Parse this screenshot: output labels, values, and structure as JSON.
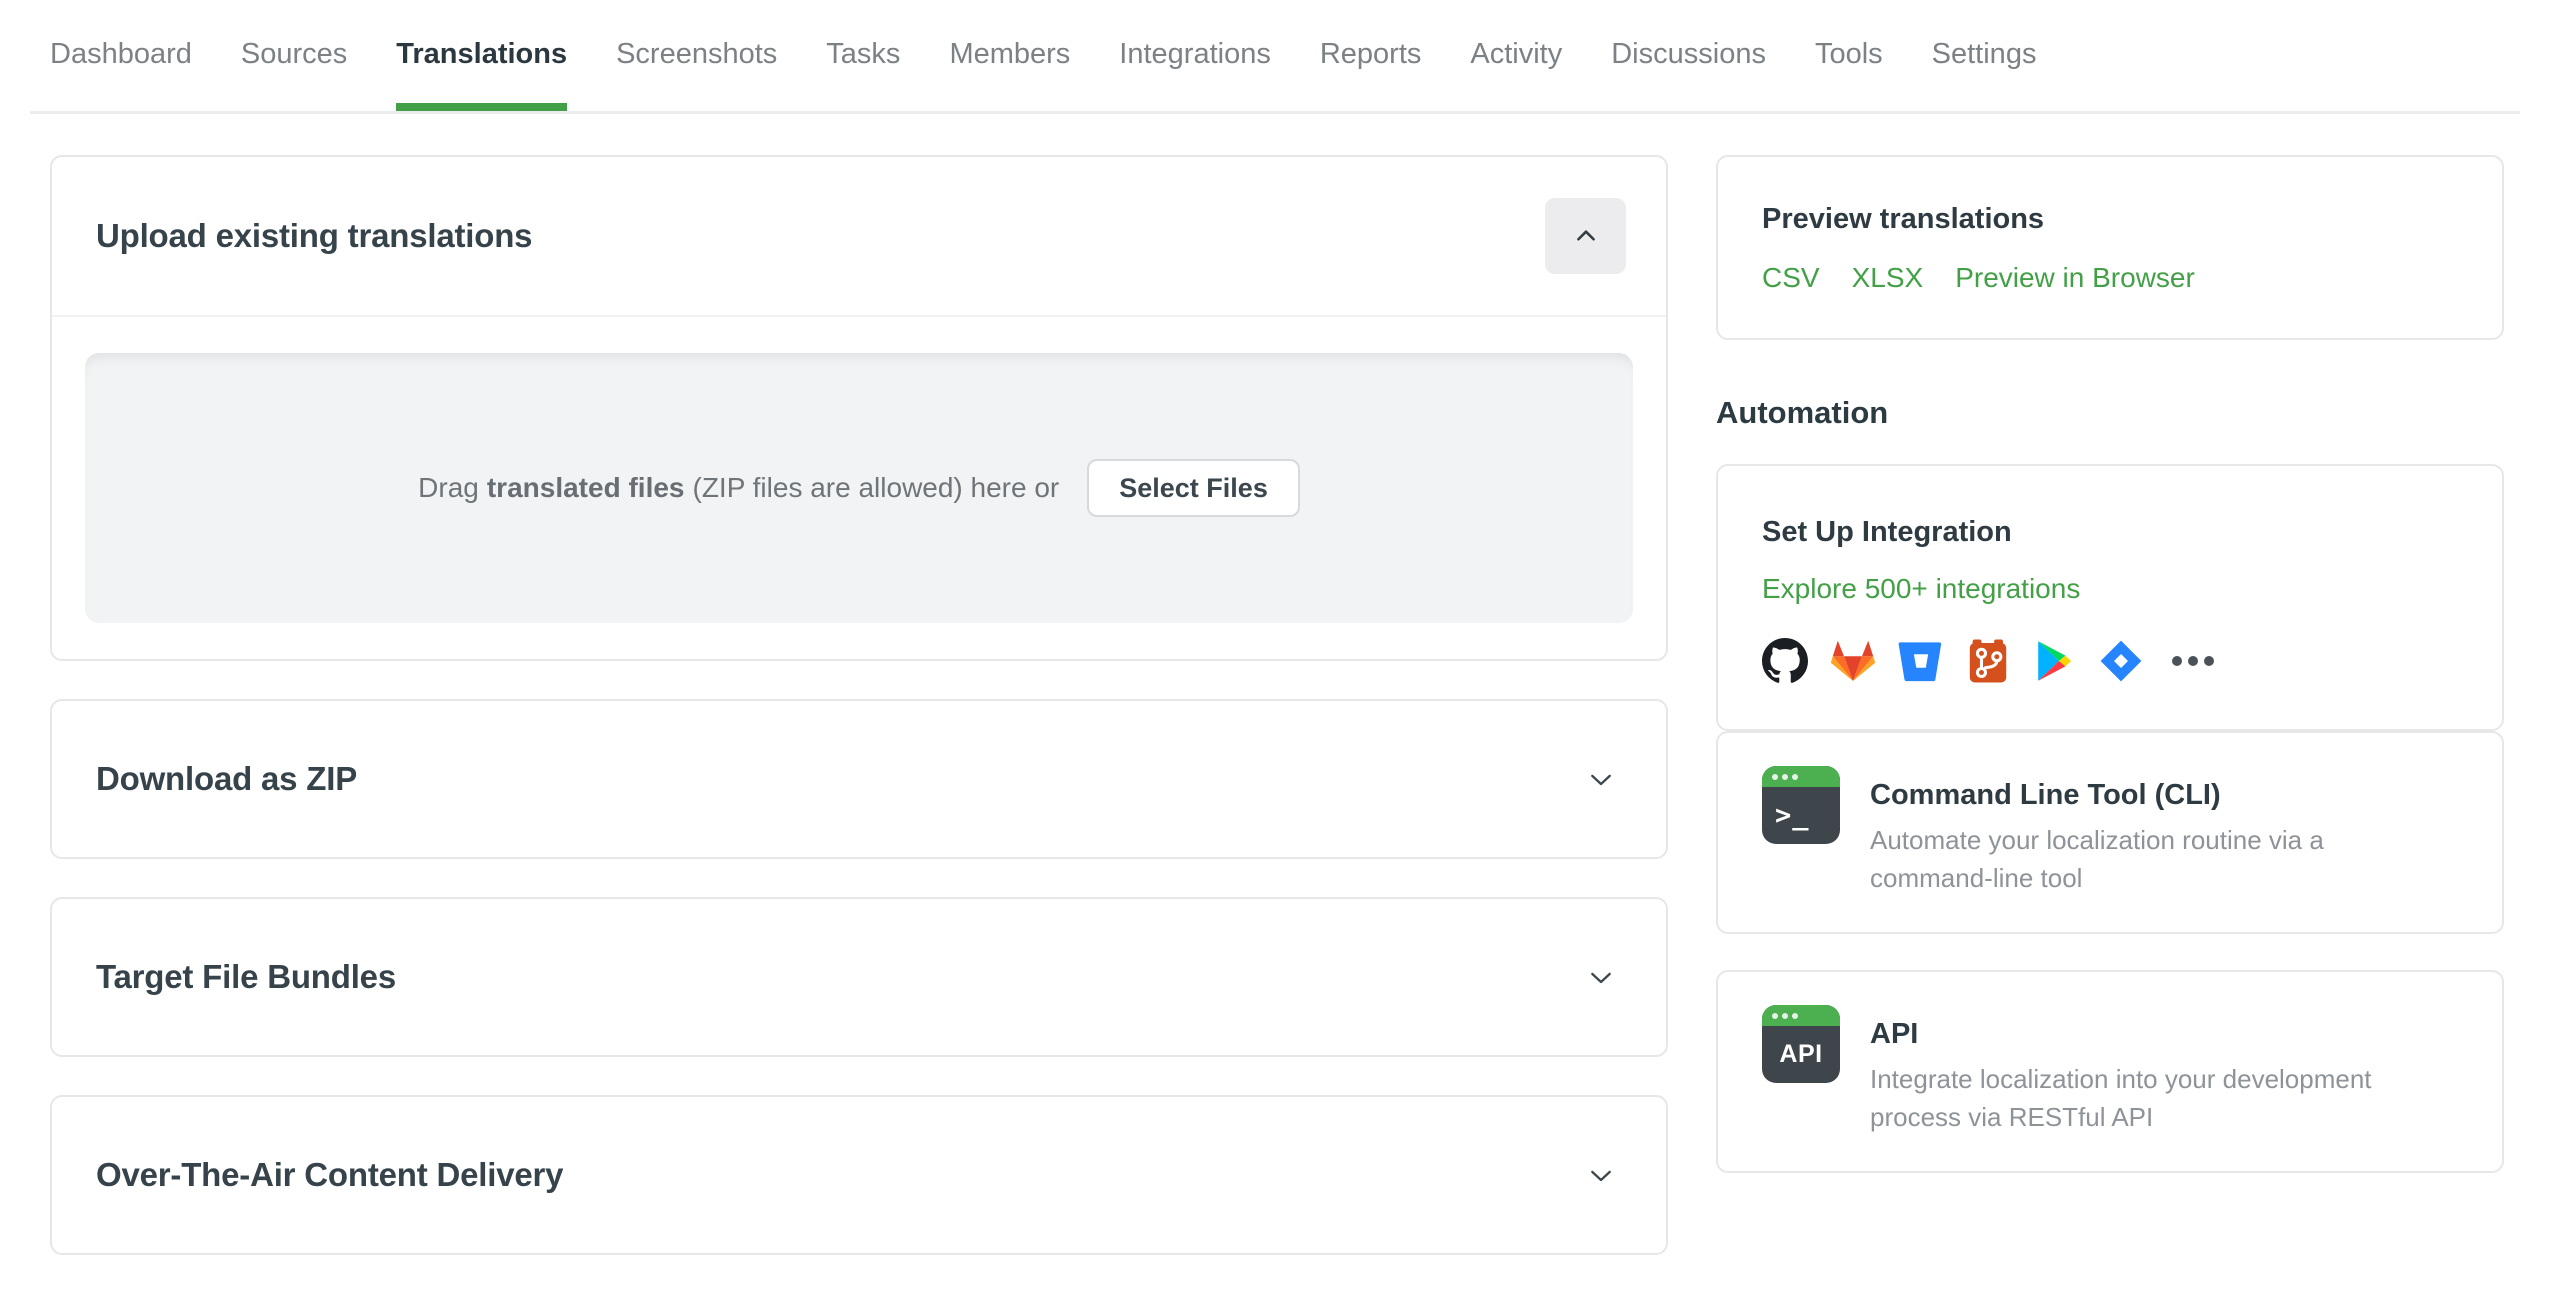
{
  "colors": {
    "accent_green": "#43a047",
    "tab_active": "#2b3840",
    "heading_dark": "#36434b",
    "muted_text": "#8d9398",
    "terminal_bar_green": "#4caf50",
    "terminal_body_dark": "#3e464b"
  },
  "nav": {
    "tabs": [
      {
        "label": "Dashboard",
        "active": false
      },
      {
        "label": "Sources",
        "active": false
      },
      {
        "label": "Translations",
        "active": true
      },
      {
        "label": "Screenshots",
        "active": false
      },
      {
        "label": "Tasks",
        "active": false
      },
      {
        "label": "Members",
        "active": false
      },
      {
        "label": "Integrations",
        "active": false
      },
      {
        "label": "Reports",
        "active": false
      },
      {
        "label": "Activity",
        "active": false
      },
      {
        "label": "Discussions",
        "active": false
      },
      {
        "label": "Tools",
        "active": false
      },
      {
        "label": "Settings",
        "active": false
      }
    ]
  },
  "upload": {
    "title": "Upload existing translations",
    "collapse_icon": "chevron-up",
    "drag_prefix": "Drag",
    "drag_bold": "translated files",
    "drag_suffix": "(ZIP files are allowed) here or",
    "select_button": "Select Files"
  },
  "collapsed_panels": [
    {
      "title": "Download as ZIP",
      "icon": "chevron-down"
    },
    {
      "title": "Target File Bundles",
      "icon": "chevron-down"
    },
    {
      "title": "Over-The-Air Content Delivery",
      "icon": "chevron-down"
    }
  ],
  "sidebar": {
    "preview": {
      "title": "Preview translations",
      "links": [
        {
          "label": "CSV"
        },
        {
          "label": "XLSX"
        },
        {
          "label": "Preview in Browser"
        }
      ]
    },
    "automation_heading": "Automation",
    "integration": {
      "title": "Set Up Integration",
      "link": "Explore 500+ integrations",
      "icons": [
        "github-icon",
        "gitlab-icon",
        "bitbucket-icon",
        "git-icon",
        "google-play-icon",
        "jira-icon",
        "more-icon"
      ]
    },
    "cli": {
      "title": "Command Line Tool (CLI)",
      "description": "Automate your localization routine via a\ncommand-line tool",
      "icon_text": ">_"
    },
    "api": {
      "title": "API",
      "description": "Integrate localization into your development\nprocess via RESTful API",
      "icon_text": "API"
    }
  }
}
